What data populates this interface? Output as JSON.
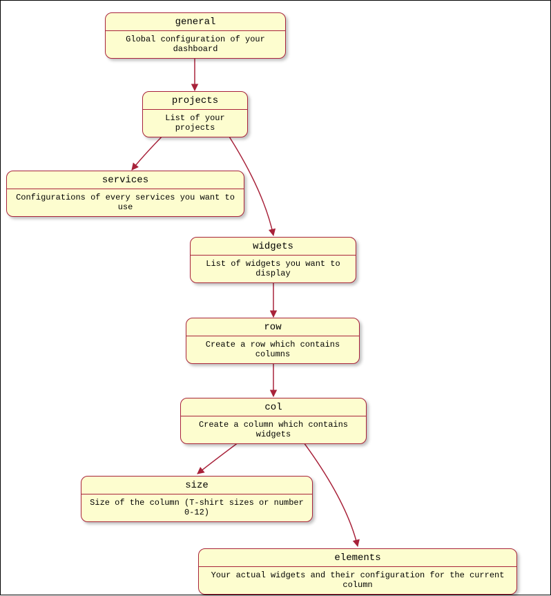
{
  "nodes": {
    "general": {
      "title": "general",
      "desc": "Global configuration of your dashboard"
    },
    "projects": {
      "title": "projects",
      "desc": "List of your projects"
    },
    "services": {
      "title": "services",
      "desc": "Configurations of every services you want to use"
    },
    "widgets": {
      "title": "widgets",
      "desc": "List of widgets you want to display"
    },
    "row": {
      "title": "row",
      "desc": "Create a row which contains columns"
    },
    "col": {
      "title": "col",
      "desc": "Create a column which contains widgets"
    },
    "size": {
      "title": "size",
      "desc": "Size of the column (T-shirt sizes or number 0-12)"
    },
    "elements": {
      "title": "elements",
      "desc": "Your actual widgets and their configuration for the current column"
    }
  }
}
